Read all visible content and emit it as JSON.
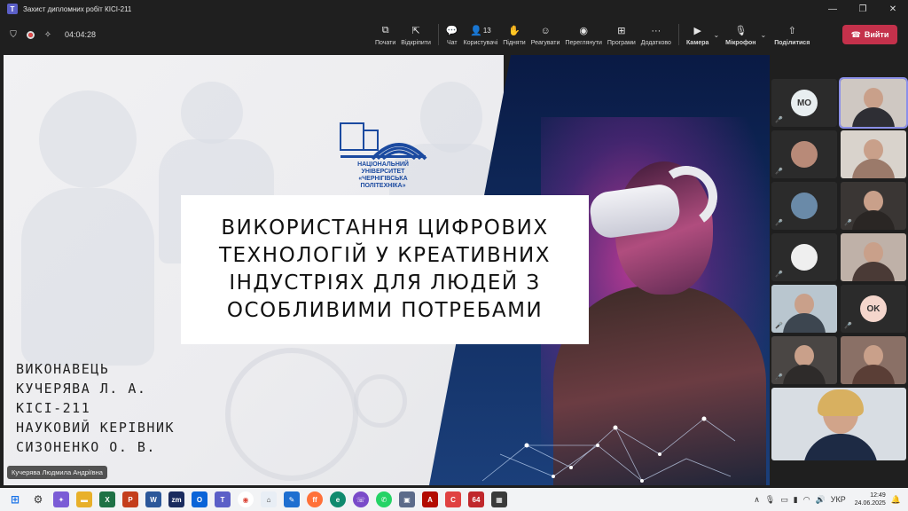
{
  "window": {
    "title": "Захист дипломних робіт КІСІ-211",
    "controls": {
      "minimize": "—",
      "restore": "❐",
      "close": "✕"
    }
  },
  "meeting": {
    "timer": "04:04:28",
    "participants_count": "13",
    "toolbar": [
      {
        "id": "start",
        "label": "Почати",
        "icon": "screen-share-icon"
      },
      {
        "id": "unpin",
        "label": "Відкріпити",
        "icon": "unpin-icon"
      },
      {
        "id": "chat",
        "label": "Чат",
        "icon": "chat-icon"
      },
      {
        "id": "people",
        "label": "Користувачі",
        "icon": "people-icon"
      },
      {
        "id": "raise",
        "label": "Підняти",
        "icon": "hand-icon"
      },
      {
        "id": "react",
        "label": "Реагувати",
        "icon": "smile-icon"
      },
      {
        "id": "view",
        "label": "Переглянути",
        "icon": "view-icon"
      },
      {
        "id": "apps",
        "label": "Програми",
        "icon": "apps-icon"
      },
      {
        "id": "more",
        "label": "Додатково",
        "icon": "more-icon"
      }
    ],
    "camera_label": "Камера",
    "mic_label": "Мікрофон",
    "share_label": "Поділитися",
    "leave_label": "Вийти"
  },
  "slide": {
    "university_line1": "НАЦІОНАЛЬНИЙ УНІВЕРСИТЕТ",
    "university_line2": "«ЧЕРНІГІВСЬКА ПОЛІТЕХНІКА»",
    "title_lines": [
      "ВИКОРИСТАННЯ ЦИФРОВИХ",
      "ТЕХНОЛОГІЙ У КРЕАТИВНИХ",
      "ІНДУСТРІЯХ ДЛЯ ЛЮДЕЙ З",
      "ОСОБЛИВИМИ ПОТРЕБАМИ"
    ],
    "author_lines": [
      "ВИКОНАВЕЦЬ",
      "КУЧЕРЯВА Л. А.",
      "КІСІ-211",
      "НАУКОВИЙ КЕРІВНИК",
      "СИЗОНЕНКО О. В."
    ]
  },
  "presenter_name": "Кучерява Людмила Андріївна",
  "participants": [
    {
      "initials": "MO",
      "avatar_color": "#e8eef0"
    },
    {
      "initials": "",
      "video": true
    },
    {
      "initials": "",
      "avatar_photo": true
    },
    {
      "initials": "",
      "video": true
    },
    {
      "initials": "",
      "avatar_photo": true
    },
    {
      "initials": "",
      "video": true
    },
    {
      "initials": "",
      "avatar_photo": true
    },
    {
      "initials": "",
      "video": true
    },
    {
      "initials": "",
      "video": true
    },
    {
      "initials": "OK",
      "avatar_color": "#f4d6cc"
    },
    {
      "initials": "",
      "video": true
    },
    {
      "initials": "",
      "video": true
    }
  ],
  "taskbar": {
    "language": "УКР",
    "time": "12:49",
    "date": "24.06.2025"
  },
  "colors": {
    "leave": "#c4314b",
    "teams_accent": "#5b5fc7",
    "title_bg": "#ffffff"
  }
}
